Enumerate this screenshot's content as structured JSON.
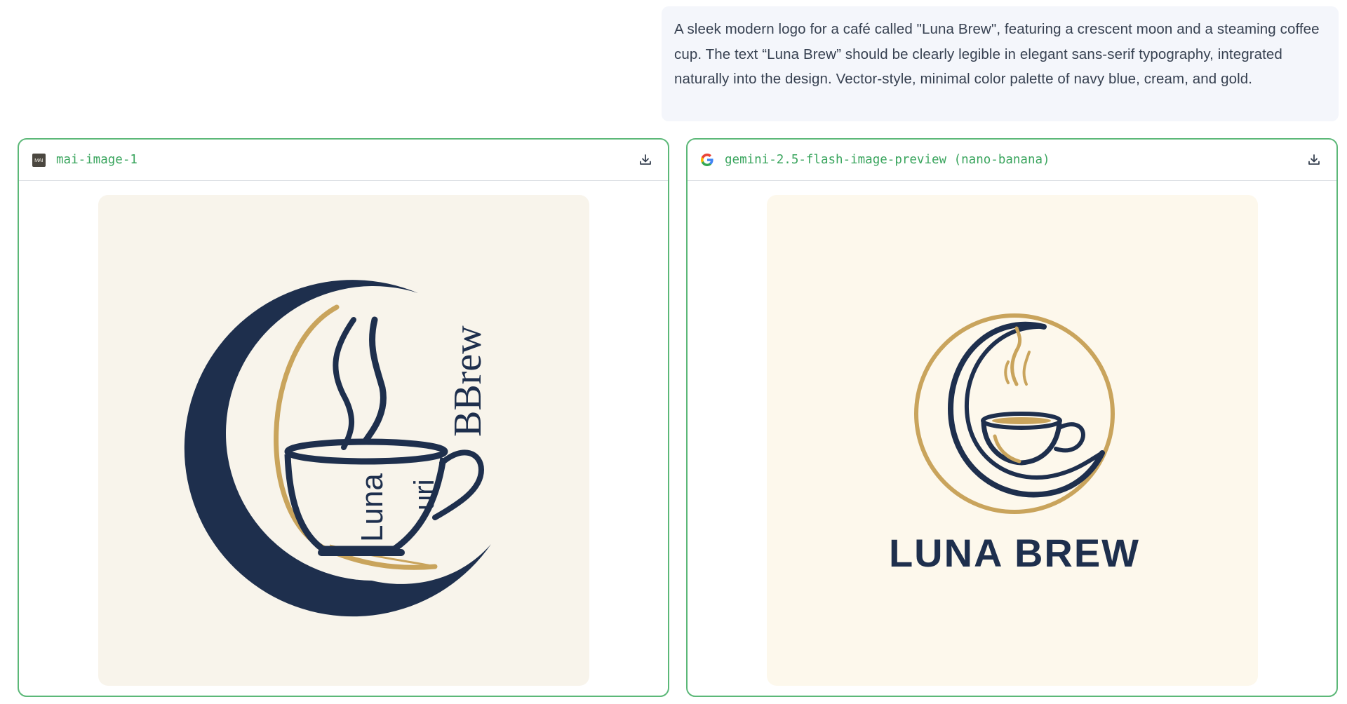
{
  "prompt": {
    "text": "A sleek modern logo for a café called \"Luna Brew\", featuring a crescent moon and a steaming coffee cup. The text “Luna Brew” should be clearly legible in elegant sans-serif typography, integrated naturally into the design. Vector-style, minimal color palette of navy blue, cream, and gold."
  },
  "panels": [
    {
      "model_name": "mai-image-1",
      "icon": "mai-logo-icon",
      "icon_text": "MAI",
      "download_icon": "download-icon",
      "image": {
        "text_word_1": "Luna",
        "text_word_2": "uri",
        "text_word_3": "BBrew"
      }
    },
    {
      "model_name": "gemini-2.5-flash-image-preview (nano-banana)",
      "icon": "google-g-icon",
      "download_icon": "download-icon",
      "image": {
        "text": "LUNA BREW"
      }
    }
  ],
  "colors": {
    "navy": "#1e2f4d",
    "gold": "#c9a45c",
    "cream_left": "#f8f4eb",
    "cream_right": "#fdf8ec",
    "accent_green": "#3aa55e",
    "panel_border": "#5cb878"
  }
}
